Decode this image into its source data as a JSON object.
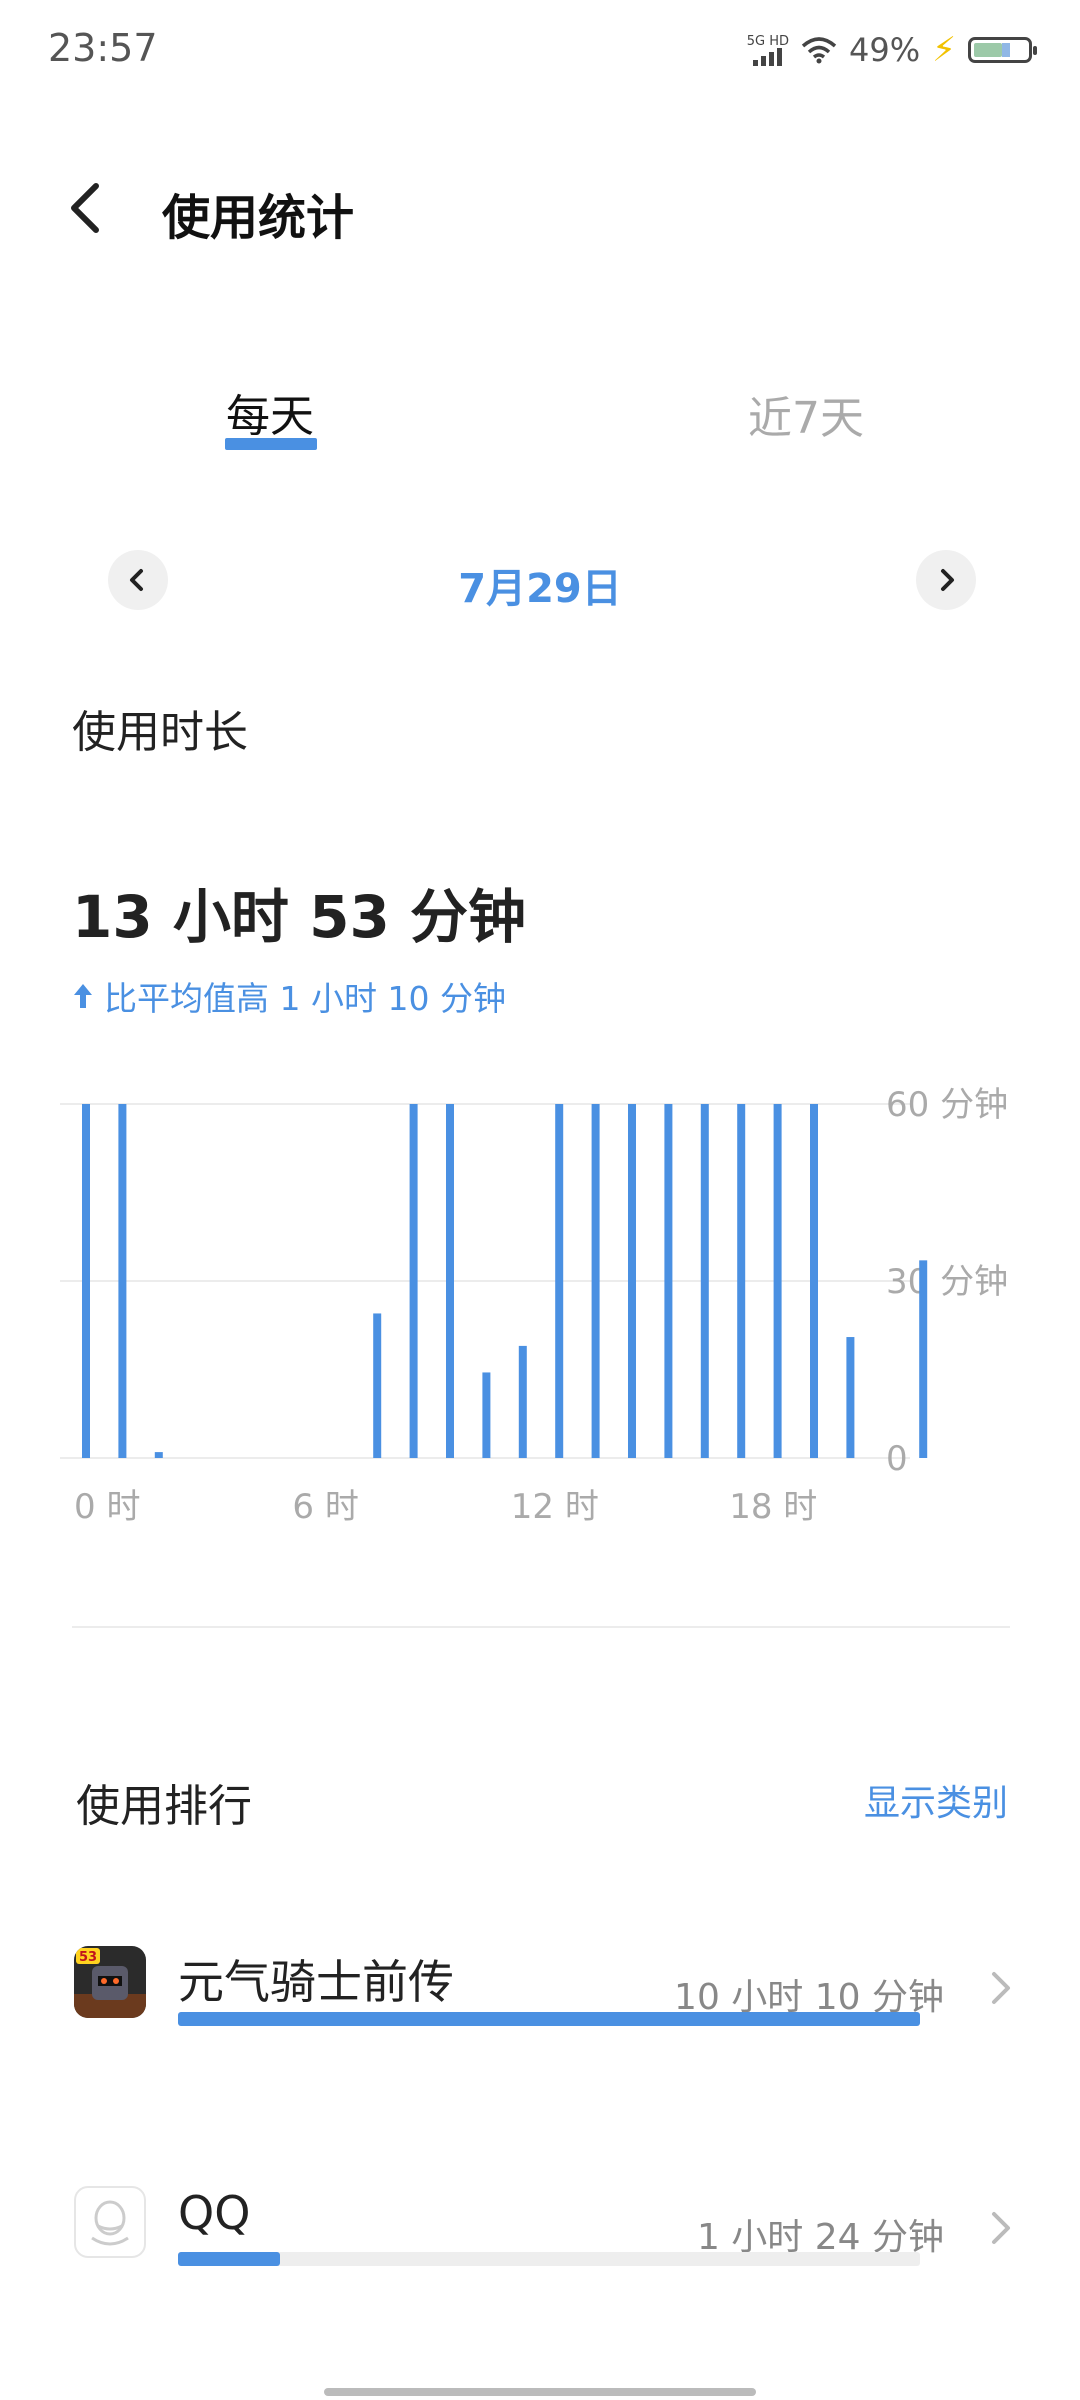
{
  "status_bar": {
    "time": "23:57",
    "network": "5G HD",
    "battery": "49%",
    "icons": [
      "signal-icon",
      "wifi-icon",
      "charging-bolt-icon",
      "battery-icon"
    ]
  },
  "header": {
    "title": "使用统计",
    "back_icon": "chevron-left-icon"
  },
  "tabs": [
    {
      "label": "每天",
      "active": true
    },
    {
      "label": "近7天",
      "active": false
    }
  ],
  "date_nav": {
    "date": "7月29日",
    "prev_icon": "chevron-left-icon",
    "next_icon": "chevron-right-icon"
  },
  "usage": {
    "heading": "使用时长",
    "total": "13 小时 53 分钟",
    "comparison": "比平均值高 1 小时 10 分钟",
    "comparison_icon": "arrow-up-icon"
  },
  "chart_data": {
    "type": "bar",
    "categories": [
      "0",
      "1",
      "2",
      "3",
      "4",
      "5",
      "6",
      "7",
      "8",
      "9",
      "10",
      "11",
      "12",
      "13",
      "14",
      "15",
      "16",
      "17",
      "18",
      "19",
      "20",
      "21",
      "22",
      "23"
    ],
    "values": [
      60,
      60,
      1,
      0,
      0,
      0,
      0,
      0,
      24.5,
      60,
      60,
      14.5,
      19,
      60,
      60,
      60,
      60,
      60,
      60,
      60,
      60,
      20.5,
      0,
      33.5
    ],
    "xtick_labels": [
      "0 时",
      "6 时",
      "12 时",
      "18 时"
    ],
    "xtick_positions": [
      0,
      6,
      12,
      18
    ],
    "ytick_labels": [
      "60 分钟",
      "30 分钟",
      "0"
    ],
    "ytick_values": [
      60,
      30,
      0
    ],
    "ylim": [
      0,
      60
    ],
    "color": "#4a90e2"
  },
  "ranking": {
    "heading": "使用排行",
    "toggle_label": "显示类别",
    "apps": [
      {
        "name": "元气骑士前传",
        "time": "10 小时 10 分钟",
        "progress": 1.0,
        "icon": "soul-knight-app-icon"
      },
      {
        "name": "QQ",
        "time": "1 小时 24 分钟",
        "progress": 0.138,
        "icon": "qq-app-icon"
      }
    ]
  },
  "colors": {
    "accent": "#4a90e2",
    "muted": "#aaaaaa"
  }
}
